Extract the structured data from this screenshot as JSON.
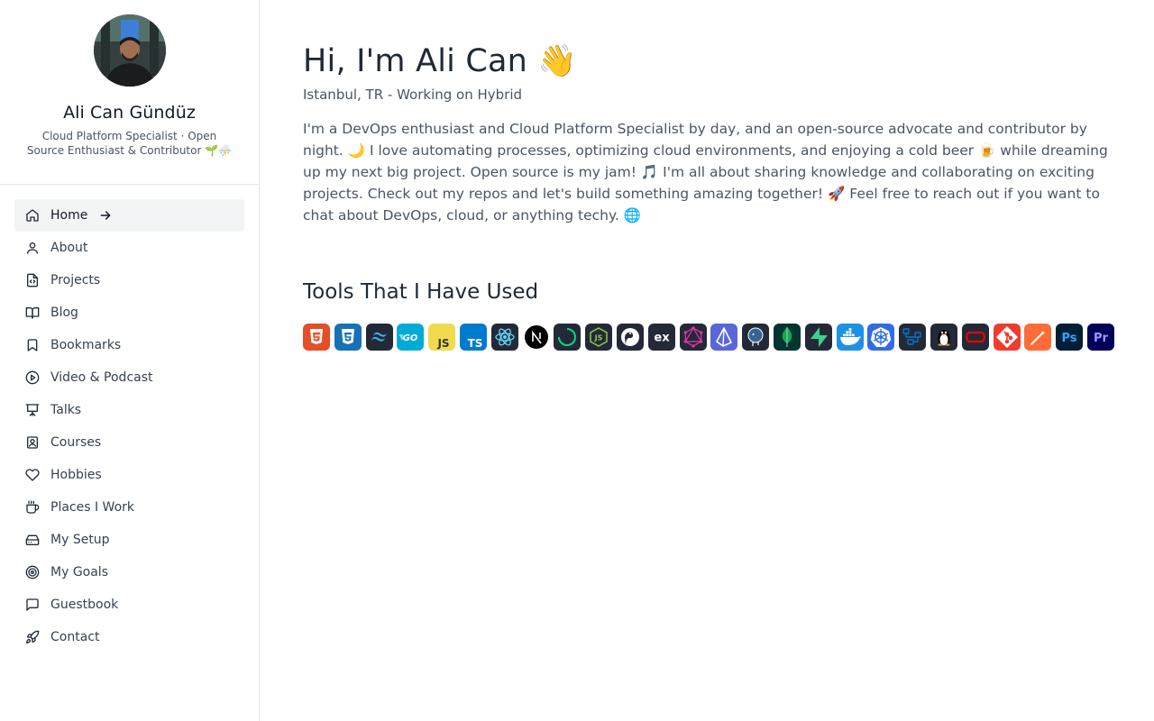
{
  "profile": {
    "name": "Ali Can Gündüz",
    "bio": "Cloud Platform Specialist · Open Source Enthusiast & Contributor 🌱⛈️"
  },
  "nav": {
    "items": [
      {
        "label": "Home",
        "icon": "home-icon",
        "active": true
      },
      {
        "label": "About",
        "icon": "user-icon"
      },
      {
        "label": "Projects",
        "icon": "file-code-icon"
      },
      {
        "label": "Blog",
        "icon": "book-open-icon"
      },
      {
        "label": "Bookmarks",
        "icon": "bookmark-icon"
      },
      {
        "label": "Video & Podcast",
        "icon": "play-circle-icon"
      },
      {
        "label": "Talks",
        "icon": "presentation-icon"
      },
      {
        "label": "Courses",
        "icon": "contact-icon"
      },
      {
        "label": "Hobbies",
        "icon": "heart-icon"
      },
      {
        "label": "Places I Work",
        "icon": "coffee-icon"
      },
      {
        "label": "My Setup",
        "icon": "hard-drive-icon"
      },
      {
        "label": "My Goals",
        "icon": "target-icon"
      },
      {
        "label": "Guestbook",
        "icon": "message-square-icon"
      },
      {
        "label": "Contact",
        "icon": "rocket-icon"
      }
    ]
  },
  "main": {
    "headline": "Hi, I'm Ali Can 👋",
    "location": "Istanbul, TR - Working on Hybrid",
    "intro": "I'm a DevOps enthusiast and Cloud Platform Specialist by day, and an open-source advocate and contributor by night. 🌙 I love automating processes, optimizing cloud environments, and enjoying a cold beer 🍺 while dreaming up my next big project. Open source is my jam! 🎵 I'm all about sharing knowledge and collaborating on exciting projects. Check out my repos and let's build something amazing together! 🚀 Feel free to reach out if you want to chat about DevOps, cloud, or anything techy. 🌐",
    "tools_title": "Tools That I Have Used",
    "tools": [
      {
        "icon": "html5-icon",
        "bg": "#e34f26"
      },
      {
        "icon": "css3-icon",
        "bg": "#1572b6"
      },
      {
        "icon": "tailwind-icon",
        "bg": "#242938"
      },
      {
        "icon": "go-icon",
        "bg": "#00acd7"
      },
      {
        "icon": "javascript-icon",
        "bg": "#f0db4f"
      },
      {
        "icon": "typescript-icon",
        "bg": "#007acc"
      },
      {
        "icon": "react-icon",
        "bg": "#242938"
      },
      {
        "icon": "nextjs-icon",
        "bg": "#ffffff"
      },
      {
        "icon": "nuxt-icon",
        "bg": "#242938"
      },
      {
        "icon": "nodejs-icon",
        "bg": "#242938"
      },
      {
        "icon": "deno-icon",
        "bg": "#242938"
      },
      {
        "icon": "express-icon",
        "bg": "#242938"
      },
      {
        "icon": "graphql-icon",
        "bg": "#242938"
      },
      {
        "icon": "prisma-icon",
        "bg": "#5a67d8"
      },
      {
        "icon": "postgresql-icon",
        "bg": "#242938"
      },
      {
        "icon": "mongodb-icon",
        "bg": "#023430"
      },
      {
        "icon": "supabase-icon",
        "bg": "#242938"
      },
      {
        "icon": "docker-icon",
        "bg": "#1d91e6"
      },
      {
        "icon": "kubernetes-icon",
        "bg": "#326ce5"
      },
      {
        "icon": "azure-devops-icon",
        "bg": "#242938"
      },
      {
        "icon": "linux-icon",
        "bg": "#242938"
      },
      {
        "icon": "openshift-icon",
        "bg": "#242938"
      },
      {
        "icon": "git-icon",
        "bg": "#f03c2e"
      },
      {
        "icon": "postman-icon",
        "bg": "#ff6c37"
      },
      {
        "icon": "photoshop-icon",
        "bg": "#001e36"
      },
      {
        "icon": "premiere-icon",
        "bg": "#00005b"
      }
    ]
  }
}
